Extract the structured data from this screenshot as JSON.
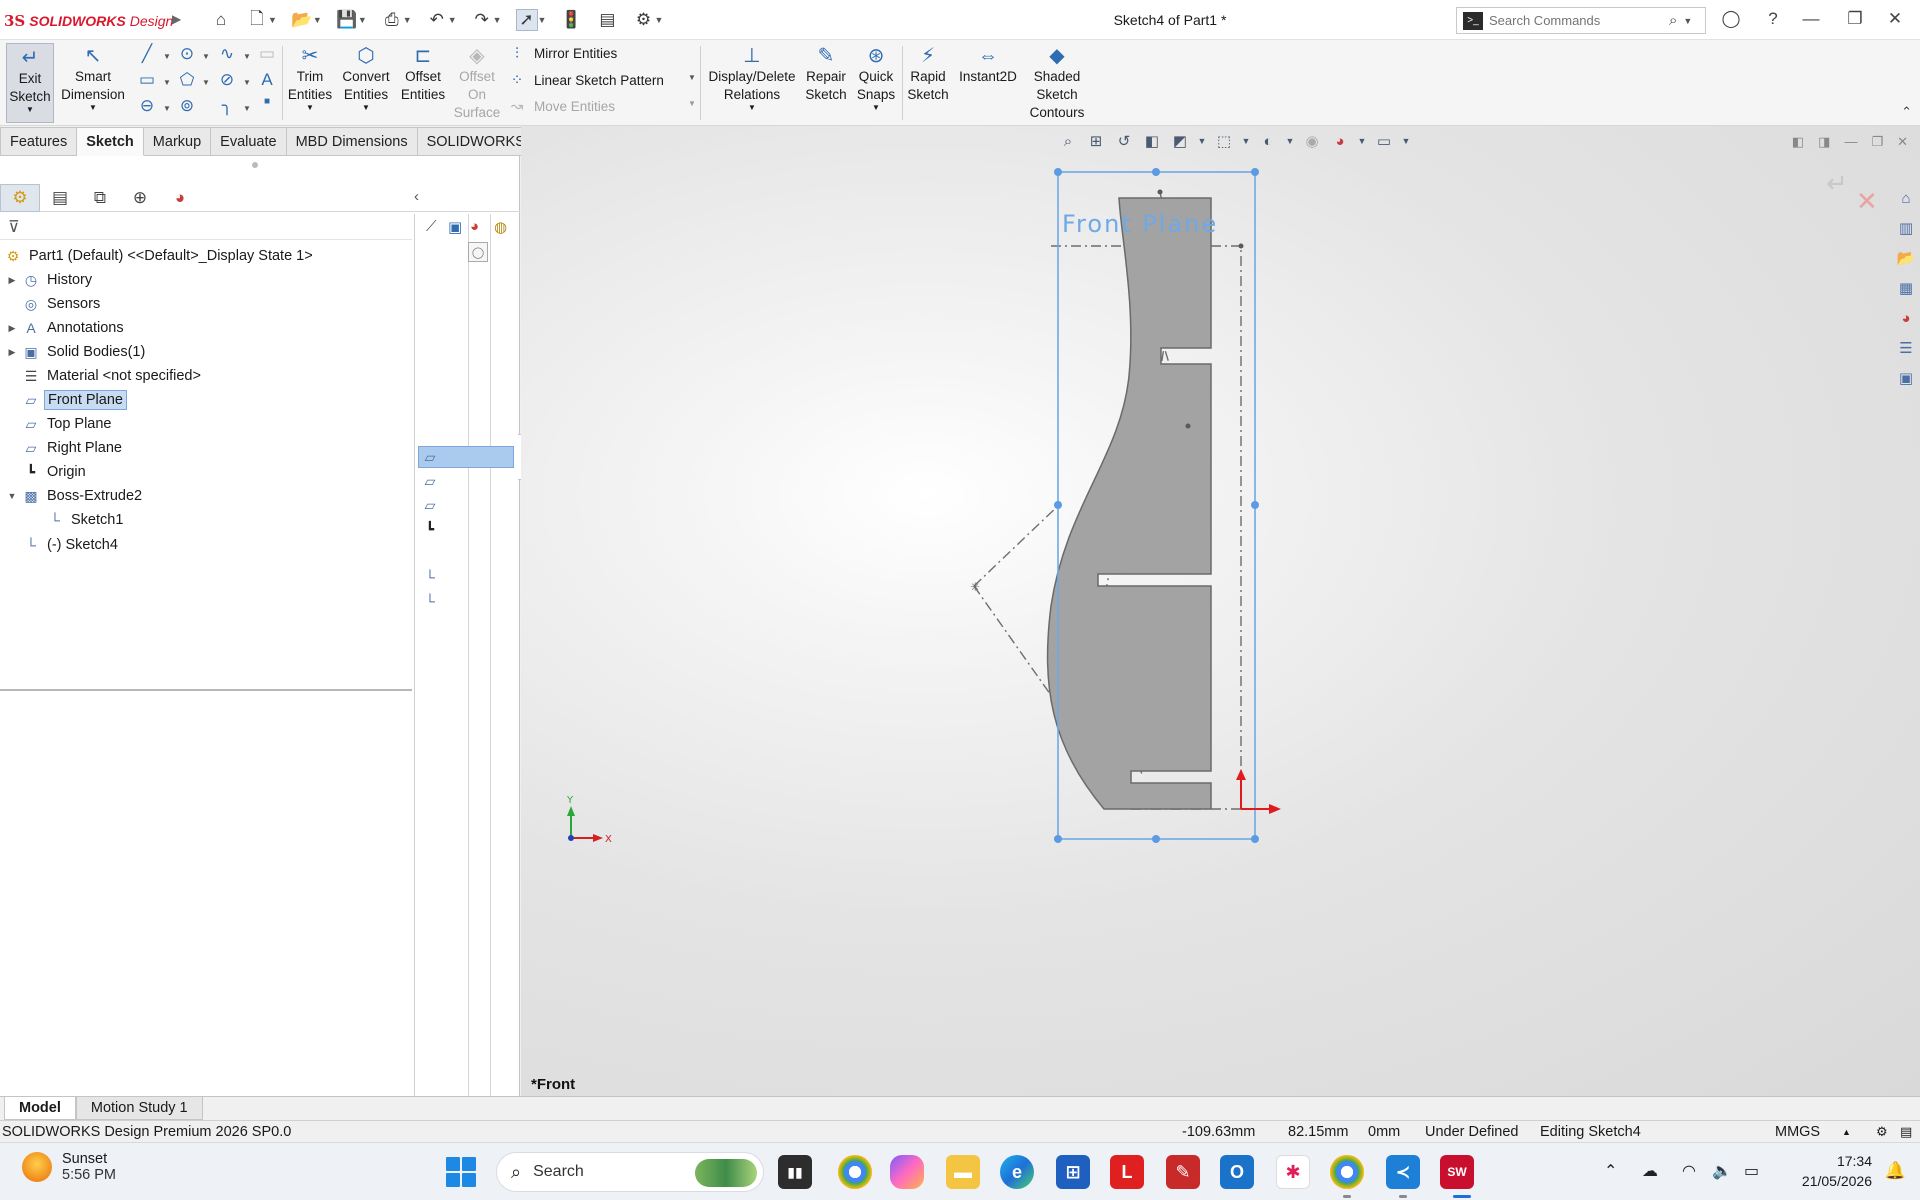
{
  "window": {
    "brand_ds": "3S",
    "brand_name": "SOLIDWORKS",
    "brand_suffix": "Design",
    "doc_title": "Sketch4 of Part1 *",
    "search_placeholder": "Search Commands"
  },
  "ribbon": {
    "exit_sketch": [
      "Exit",
      "Sketch"
    ],
    "smart_dimension": [
      "Smart",
      "Dimension"
    ],
    "trim_entities": [
      "Trim",
      "Entities"
    ],
    "convert_entities": [
      "Convert",
      "Entities"
    ],
    "offset_entities": [
      "Offset",
      "Entities"
    ],
    "offset_on_surface": [
      "Offset",
      "On",
      "Surface"
    ],
    "mirror_entities": "Mirror Entities",
    "linear_sketch_pattern": "Linear Sketch Pattern",
    "move_entities": "Move Entities",
    "display_delete_relations": [
      "Display/Delete",
      "Relations"
    ],
    "repair_sketch": [
      "Repair",
      "Sketch"
    ],
    "quick_snaps": [
      "Quick",
      "Snaps"
    ],
    "rapid_sketch": [
      "Rapid",
      "Sketch"
    ],
    "instant2d": "Instant2D",
    "shaded_sketch_contours": [
      "Shaded",
      "Sketch",
      "Contours"
    ]
  },
  "tabs": [
    "Features",
    "Sketch",
    "Markup",
    "Evaluate",
    "MBD Dimensions",
    "SOLIDWORKS Add-Ins"
  ],
  "active_tab": "Sketch",
  "tree": {
    "root": "Part1 (Default) <<Default>_Display State 1>",
    "items": [
      {
        "label": "History",
        "expandable": true
      },
      {
        "label": "Sensors",
        "expandable": false
      },
      {
        "label": "Annotations",
        "expandable": true
      },
      {
        "label": "Solid Bodies(1)",
        "expandable": true
      },
      {
        "label": "Material <not specified>",
        "expandable": false
      },
      {
        "label": "Front Plane",
        "expandable": false,
        "selected": true
      },
      {
        "label": "Top Plane",
        "expandable": false
      },
      {
        "label": "Right Plane",
        "expandable": false
      },
      {
        "label": "Origin",
        "expandable": false
      },
      {
        "label": "Boss-Extrude2",
        "expandable": true,
        "expanded": true
      },
      {
        "label": "Sketch1",
        "expandable": false,
        "child": true
      },
      {
        "label": "(-) Sketch4",
        "expandable": false
      }
    ]
  },
  "viewport": {
    "plane_label": "Front Plane",
    "view_name": "*Front",
    "triad_y": "Y",
    "triad_x": "X"
  },
  "bottom_tabs": [
    "Model",
    "Motion Study 1"
  ],
  "status": {
    "product": "SOLIDWORKS Design Premium 2026 SP0.0",
    "x": "-109.63mm",
    "y": "82.15mm",
    "z": "0mm",
    "state": "Under Defined",
    "editing": "Editing Sketch4",
    "units": "MMGS"
  },
  "taskbar": {
    "weather_title": "Sunset",
    "weather_time": "5:56 PM",
    "search": "Search",
    "time": "17:34",
    "date": "21/05/2026"
  },
  "colors": {
    "brand": "#d9182d",
    "selection": "#6fa8e6",
    "part_fill": "#a3a3a3"
  }
}
